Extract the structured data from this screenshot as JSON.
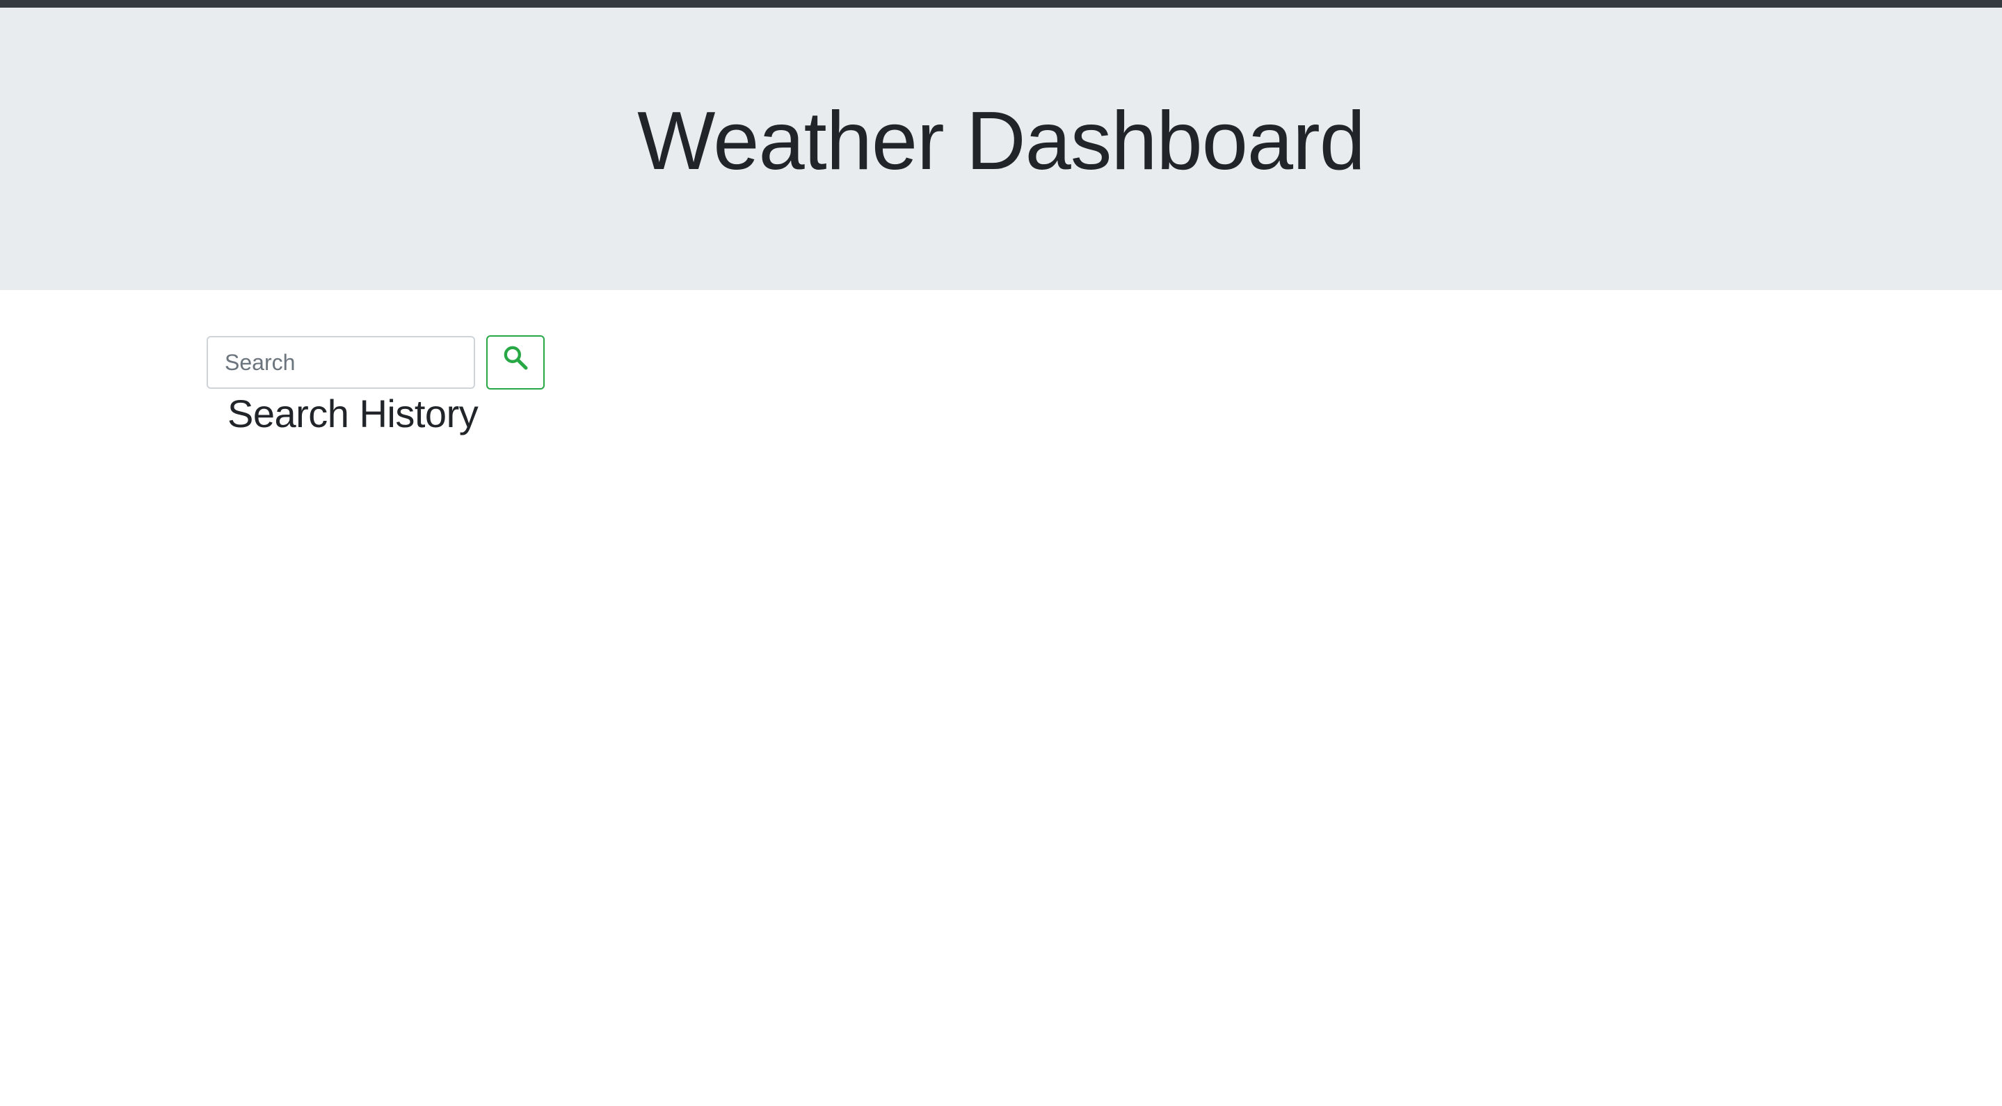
{
  "header": {
    "title": "Weather Dashboard"
  },
  "search": {
    "placeholder": "Search",
    "value": "",
    "button_icon": "search-icon"
  },
  "history": {
    "title": "Search History",
    "items": []
  },
  "colors": {
    "top_bar": "#343a40",
    "jumbotron": "#e9ecef",
    "accent": "#28a745",
    "text": "#212529",
    "input_border": "#ced4da"
  }
}
